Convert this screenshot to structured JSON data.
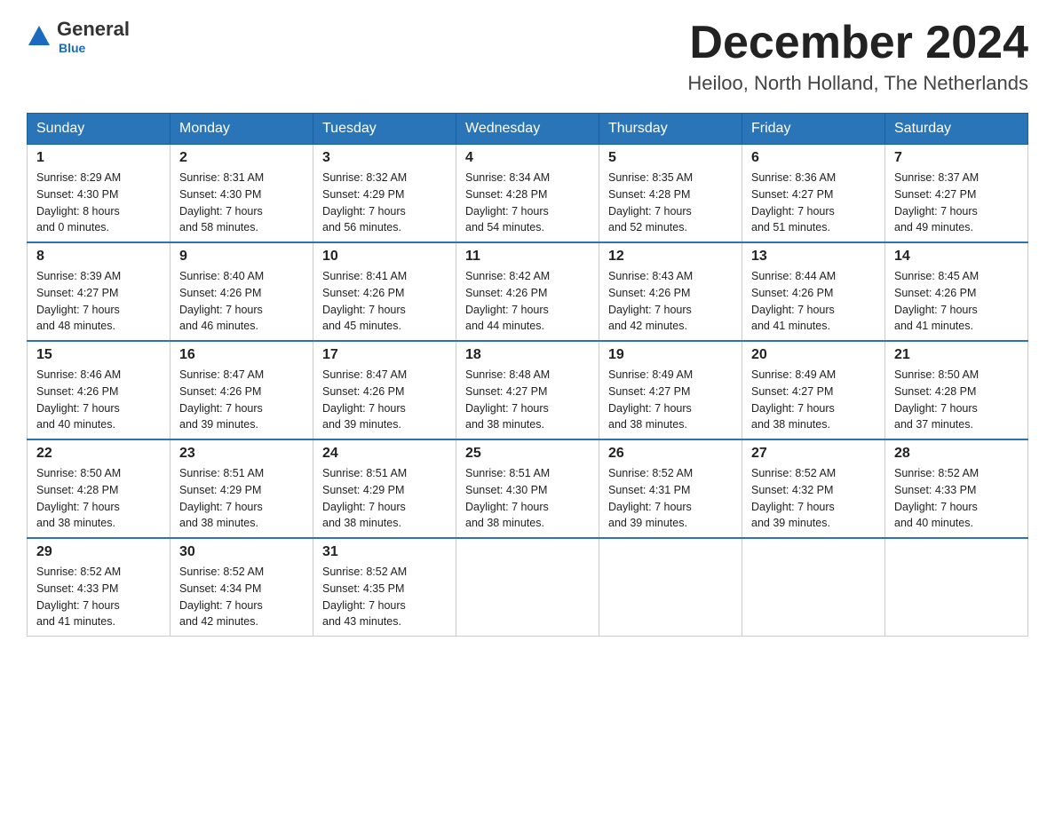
{
  "logo": {
    "general": "General",
    "blue": "Blue"
  },
  "header": {
    "month": "December 2024",
    "location": "Heiloo, North Holland, The Netherlands"
  },
  "weekdays": [
    "Sunday",
    "Monday",
    "Tuesday",
    "Wednesday",
    "Thursday",
    "Friday",
    "Saturday"
  ],
  "weeks": [
    [
      {
        "day": "1",
        "sunrise": "8:29 AM",
        "sunset": "4:30 PM",
        "daylight": "8 hours and 0 minutes."
      },
      {
        "day": "2",
        "sunrise": "8:31 AM",
        "sunset": "4:30 PM",
        "daylight": "7 hours and 58 minutes."
      },
      {
        "day": "3",
        "sunrise": "8:32 AM",
        "sunset": "4:29 PM",
        "daylight": "7 hours and 56 minutes."
      },
      {
        "day": "4",
        "sunrise": "8:34 AM",
        "sunset": "4:28 PM",
        "daylight": "7 hours and 54 minutes."
      },
      {
        "day": "5",
        "sunrise": "8:35 AM",
        "sunset": "4:28 PM",
        "daylight": "7 hours and 52 minutes."
      },
      {
        "day": "6",
        "sunrise": "8:36 AM",
        "sunset": "4:27 PM",
        "daylight": "7 hours and 51 minutes."
      },
      {
        "day": "7",
        "sunrise": "8:37 AM",
        "sunset": "4:27 PM",
        "daylight": "7 hours and 49 minutes."
      }
    ],
    [
      {
        "day": "8",
        "sunrise": "8:39 AM",
        "sunset": "4:27 PM",
        "daylight": "7 hours and 48 minutes."
      },
      {
        "day": "9",
        "sunrise": "8:40 AM",
        "sunset": "4:26 PM",
        "daylight": "7 hours and 46 minutes."
      },
      {
        "day": "10",
        "sunrise": "8:41 AM",
        "sunset": "4:26 PM",
        "daylight": "7 hours and 45 minutes."
      },
      {
        "day": "11",
        "sunrise": "8:42 AM",
        "sunset": "4:26 PM",
        "daylight": "7 hours and 44 minutes."
      },
      {
        "day": "12",
        "sunrise": "8:43 AM",
        "sunset": "4:26 PM",
        "daylight": "7 hours and 42 minutes."
      },
      {
        "day": "13",
        "sunrise": "8:44 AM",
        "sunset": "4:26 PM",
        "daylight": "7 hours and 41 minutes."
      },
      {
        "day": "14",
        "sunrise": "8:45 AM",
        "sunset": "4:26 PM",
        "daylight": "7 hours and 41 minutes."
      }
    ],
    [
      {
        "day": "15",
        "sunrise": "8:46 AM",
        "sunset": "4:26 PM",
        "daylight": "7 hours and 40 minutes."
      },
      {
        "day": "16",
        "sunrise": "8:47 AM",
        "sunset": "4:26 PM",
        "daylight": "7 hours and 39 minutes."
      },
      {
        "day": "17",
        "sunrise": "8:47 AM",
        "sunset": "4:26 PM",
        "daylight": "7 hours and 39 minutes."
      },
      {
        "day": "18",
        "sunrise": "8:48 AM",
        "sunset": "4:27 PM",
        "daylight": "7 hours and 38 minutes."
      },
      {
        "day": "19",
        "sunrise": "8:49 AM",
        "sunset": "4:27 PM",
        "daylight": "7 hours and 38 minutes."
      },
      {
        "day": "20",
        "sunrise": "8:49 AM",
        "sunset": "4:27 PM",
        "daylight": "7 hours and 38 minutes."
      },
      {
        "day": "21",
        "sunrise": "8:50 AM",
        "sunset": "4:28 PM",
        "daylight": "7 hours and 37 minutes."
      }
    ],
    [
      {
        "day": "22",
        "sunrise": "8:50 AM",
        "sunset": "4:28 PM",
        "daylight": "7 hours and 38 minutes."
      },
      {
        "day": "23",
        "sunrise": "8:51 AM",
        "sunset": "4:29 PM",
        "daylight": "7 hours and 38 minutes."
      },
      {
        "day": "24",
        "sunrise": "8:51 AM",
        "sunset": "4:29 PM",
        "daylight": "7 hours and 38 minutes."
      },
      {
        "day": "25",
        "sunrise": "8:51 AM",
        "sunset": "4:30 PM",
        "daylight": "7 hours and 38 minutes."
      },
      {
        "day": "26",
        "sunrise": "8:52 AM",
        "sunset": "4:31 PM",
        "daylight": "7 hours and 39 minutes."
      },
      {
        "day": "27",
        "sunrise": "8:52 AM",
        "sunset": "4:32 PM",
        "daylight": "7 hours and 39 minutes."
      },
      {
        "day": "28",
        "sunrise": "8:52 AM",
        "sunset": "4:33 PM",
        "daylight": "7 hours and 40 minutes."
      }
    ],
    [
      {
        "day": "29",
        "sunrise": "8:52 AM",
        "sunset": "4:33 PM",
        "daylight": "7 hours and 41 minutes."
      },
      {
        "day": "30",
        "sunrise": "8:52 AM",
        "sunset": "4:34 PM",
        "daylight": "7 hours and 42 minutes."
      },
      {
        "day": "31",
        "sunrise": "8:52 AM",
        "sunset": "4:35 PM",
        "daylight": "7 hours and 43 minutes."
      },
      null,
      null,
      null,
      null
    ]
  ],
  "labels": {
    "sunrise": "Sunrise: ",
    "sunset": "Sunset: ",
    "daylight": "Daylight: "
  }
}
